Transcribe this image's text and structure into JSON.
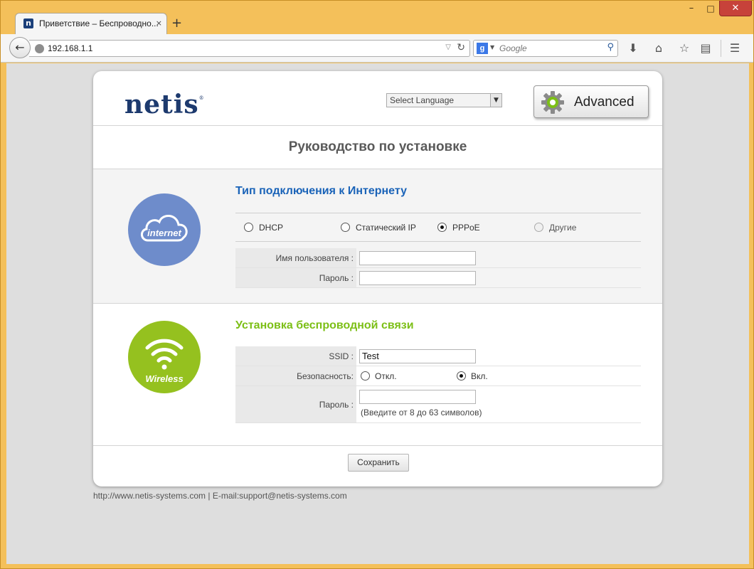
{
  "browser": {
    "tab_title": "Приветствие – Беспроводно...",
    "tab_close": "×",
    "new_tab": "+",
    "url": "192.168.1.1",
    "search_placeholder": "Google",
    "window_controls": {
      "minimize": "–",
      "maximize": "□",
      "close": "✕"
    },
    "toolbar_icons": [
      "download-icon",
      "home-icon",
      "bookmark-star-icon",
      "reading-list-icon",
      "menu-icon"
    ]
  },
  "header": {
    "logo_text": "netis",
    "logo_mark": "®",
    "language_select": "Select Language",
    "advanced_label": "Advanced"
  },
  "page": {
    "title": "Руководство по установке"
  },
  "internet": {
    "heading": "Тип подключения к Интернету",
    "icon_label": "internet",
    "options": [
      {
        "label": "DHCP",
        "selected": false,
        "disabled": false
      },
      {
        "label": "Статический IP",
        "selected": false,
        "disabled": false
      },
      {
        "label": "PPPoE",
        "selected": true,
        "disabled": false
      },
      {
        "label": "Другие",
        "selected": false,
        "disabled": true
      }
    ],
    "username_label": "Имя пользователя :",
    "username_value": "",
    "password_label": "Пароль :",
    "password_value": ""
  },
  "wireless": {
    "heading": "Установка беспроводной связи",
    "icon_label": "Wireless",
    "ssid_label": "SSID :",
    "ssid_value": "Test",
    "security_label": "Безопасность:",
    "security_off": "Откл.",
    "security_on": "Вкл.",
    "security_selected": "on",
    "password_label": "Пароль :",
    "password_value": "",
    "password_hint": "(Введите от 8 до 63 символов)"
  },
  "actions": {
    "save_label": "Сохранить"
  },
  "footer": {
    "text": "http://www.netis-systems.com | E-mail:support@netis-systems.com"
  },
  "colors": {
    "internet_accent": "#1a63b8",
    "wireless_accent": "#7cbf16",
    "internet_circle": "#6e8ccb",
    "wireless_circle": "#95c11f",
    "logo": "#1d3a6e"
  }
}
